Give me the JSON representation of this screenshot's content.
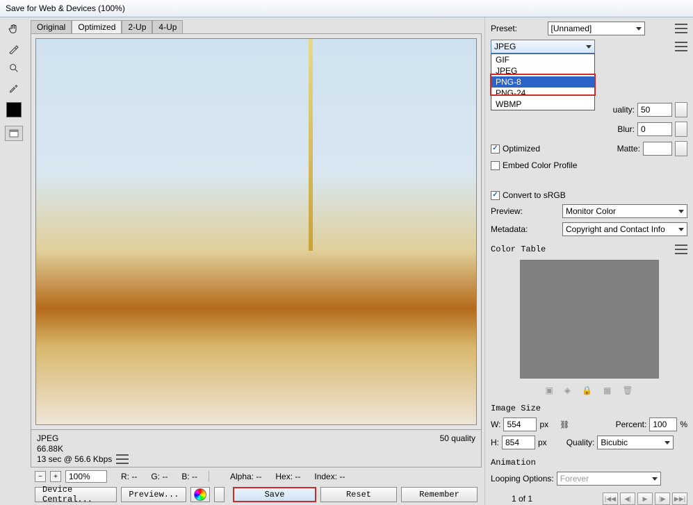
{
  "window": {
    "title": "Save for Web & Devices (100%)"
  },
  "tabs": {
    "original": "Original",
    "optimized": "Optimized",
    "two_up": "2-Up",
    "four_up": "4-Up"
  },
  "preview_info": {
    "format": "JPEG",
    "size": "66.88K",
    "speed": "13 sec @ 56.6 Kbps",
    "quality_readout": "50 quality"
  },
  "zoombar": {
    "zoom": "100%",
    "r": "R: --",
    "g": "G: --",
    "b": "B: --",
    "alpha": "Alpha: --",
    "hex": "Hex: --",
    "index": "Index: --"
  },
  "bottom_left": {
    "device_central": "Device Central...",
    "preview": "Preview..."
  },
  "bottom_right": {
    "save": "Save",
    "reset": "Reset",
    "remember": "Remember"
  },
  "right": {
    "preset_label": "Preset:",
    "preset_value": "[Unnamed]",
    "format_value": "JPEG",
    "format_options": {
      "gif": "GIF",
      "jpeg": "JPEG",
      "png8": "PNG-8",
      "png24": "PNG-24",
      "wbmp": "WBMP"
    },
    "quality_label": "uality:",
    "quality_value": "50",
    "blur_label": "Blur:",
    "blur_value": "0",
    "optimized_label": "Optimized",
    "matte_label": "Matte:",
    "embed_color_label": "Embed Color Profile",
    "convert_srgb_label": "Convert to sRGB",
    "preview_label": "Preview:",
    "preview_value": "Monitor Color",
    "metadata_label": "Metadata:",
    "metadata_value": "Copyright and Contact Info",
    "color_table_label": "Color Table",
    "image_size_label": "Image Size",
    "w_label": "W:",
    "w_value": "554",
    "px": "px",
    "h_label": "H:",
    "h_value": "854",
    "percent_label": "Percent:",
    "percent_value": "100",
    "percent_sym": "%",
    "quality2_label": "Quality:",
    "quality2_value": "Bicubic",
    "animation_label": "Animation",
    "looping_label": "Looping Options:",
    "looping_value": "Forever",
    "frame_readout": "1 of 1"
  }
}
